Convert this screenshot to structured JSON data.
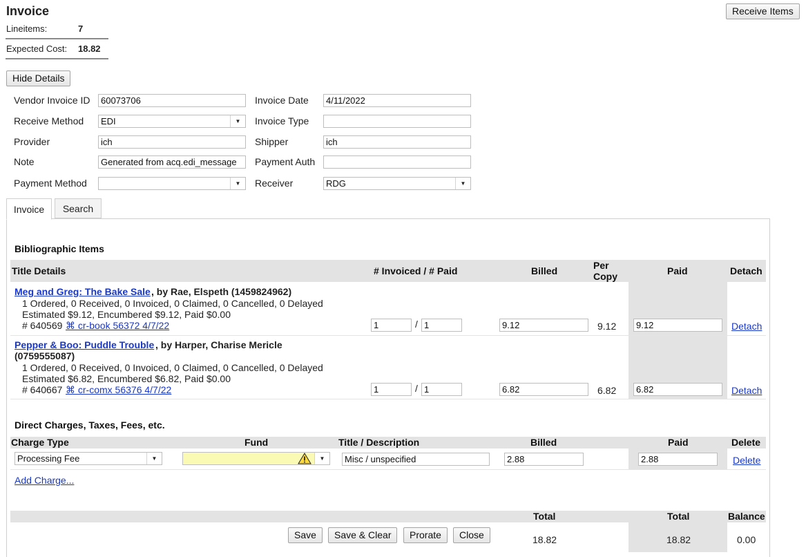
{
  "header": {
    "title": "Invoice",
    "lineitems_label": "Lineitems:",
    "lineitems_value": "7",
    "expected_cost_label": "Expected Cost:",
    "expected_cost_value": "18.82",
    "receive_items_label": "Receive Items",
    "hide_details_label": "Hide Details"
  },
  "form": {
    "vendor_invoice_id_label": "Vendor Invoice ID",
    "vendor_invoice_id_value": "60073706",
    "invoice_date_label": "Invoice Date",
    "invoice_date_value": "4/11/2022",
    "receive_method_label": "Receive Method",
    "receive_method_value": "EDI",
    "invoice_type_label": "Invoice Type",
    "invoice_type_value": "",
    "provider_label": "Provider",
    "provider_value": "ich",
    "shipper_label": "Shipper",
    "shipper_value": "ich",
    "note_label": "Note",
    "note_value": "Generated from acq.edi_message",
    "payment_auth_label": "Payment Auth",
    "payment_auth_value": "",
    "payment_method_label": "Payment Method",
    "payment_method_value": "",
    "receiver_label": "Receiver",
    "receiver_value": "RDG"
  },
  "tabs": [
    {
      "label": "Invoice"
    },
    {
      "label": "Search"
    }
  ],
  "bib": {
    "section_title": "Bibliographic Items",
    "col_title": "Title Details",
    "col_invoiced": "# Invoiced / # Paid",
    "col_billed": "Billed",
    "col_per_copy_1": "Per",
    "col_per_copy_2": "Copy",
    "col_paid": "Paid",
    "col_detach": "Detach",
    "items": [
      {
        "title": "Meg and Greg: The Bake Sale",
        "byline": ", by Rae, Elspeth (1459824962)",
        "status": "1 Ordered, 0 Received, 0 Invoiced, 0 Claimed, 0 Cancelled, 0 Delayed",
        "costs": "Estimated $9.12, Encumbered $9.12, Paid $0.00",
        "id": "# 640569",
        "po_link": "⌘ cr-book 56372 4/7/22",
        "invoiced": "1",
        "paid_count": "1",
        "billed": "9.12",
        "per_copy": "9.12",
        "paid": "9.12",
        "detach": "Detach"
      },
      {
        "title": "Pepper & Boo: Puddle Trouble",
        "byline": ", by Harper, Charise Mericle",
        "byline2": "(0759555087)",
        "status": "1 Ordered, 0 Received, 0 Invoiced, 0 Claimed, 0 Cancelled, 0 Delayed",
        "costs": "Estimated $6.82, Encumbered $6.82, Paid $0.00",
        "id": "# 640667",
        "po_link": "⌘ cr-comx 56376 4/7/22",
        "invoiced": "1",
        "paid_count": "1",
        "billed": "6.82",
        "per_copy": "6.82",
        "paid": "6.82",
        "detach": "Detach"
      }
    ]
  },
  "charges": {
    "section_title": "Direct Charges, Taxes, Fees, etc.",
    "col_type": "Charge Type",
    "col_fund": "Fund",
    "col_title": "Title / Description",
    "col_billed": "Billed",
    "col_paid": "Paid",
    "col_delete": "Delete",
    "rows": [
      {
        "type": "Processing Fee",
        "fund": "",
        "title": "Misc / unspecified",
        "billed": "2.88",
        "paid": "2.88",
        "delete": "Delete"
      }
    ],
    "add_charge": "Add Charge..."
  },
  "totals": {
    "total_label": "Total",
    "paid_total_label": "Total",
    "balance_label": "Balance",
    "total_billed": "18.82",
    "total_paid": "18.82",
    "balance": "0.00"
  },
  "actions": {
    "save": "Save",
    "save_clear": "Save & Clear",
    "prorate": "Prorate",
    "close": "Close"
  },
  "colors": {
    "link": "#1a38c7",
    "shade": "#e3e3e3",
    "fund_warning_bg": "#fafab4"
  },
  "icons": {
    "fund_warning": "warning-icon",
    "dropdown": "chevron-down-icon",
    "po_link": "command-icon"
  }
}
